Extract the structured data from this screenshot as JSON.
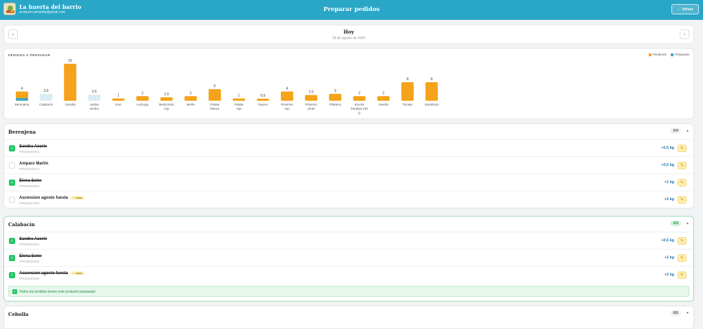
{
  "header": {
    "brand": "La huerta del barrio",
    "email": "ar.daurm.amanda@gmail.com",
    "title": "Preparar pedidos",
    "back_label": "← Volver"
  },
  "date": {
    "main": "Hoy",
    "sub": "18 de agosto de 2026",
    "prev": "‹",
    "next": "›"
  },
  "chart_title": "PEDIDOS A PREPARAR",
  "chart_data": {
    "type": "bar",
    "categories": [
      "Berenjena",
      "Calabacín",
      "Cebolla",
      "Judías verdes",
      "Kiwi",
      "Lechuga",
      "Melóctotón rojo",
      "Melón",
      "Patata blanca",
      "Patata roja",
      "Pepino",
      "Pimiento rojo",
      "Pimiento verde",
      "Plátanos",
      "Escola bandeja 100 g",
      "Sandía",
      "Tomate",
      "Zanahoria"
    ],
    "value_labels": [
      "4",
      "3.0",
      "16",
      "2.6",
      "1",
      "2",
      "1.5",
      "2",
      "5",
      "1",
      "0.5",
      "4",
      "2.5",
      "3",
      "2",
      "2",
      "8",
      "8"
    ],
    "series": [
      {
        "name": "Pendiente",
        "values": [
          2.8,
          0,
          16,
          0,
          1,
          2,
          1.5,
          2,
          5,
          1,
          0.5,
          4,
          2.5,
          3,
          2,
          2,
          8,
          8
        ]
      },
      {
        "name": "Preparado",
        "values": [
          1.2,
          3,
          0,
          2.6,
          0,
          0,
          0,
          0,
          0,
          0,
          0,
          0,
          0,
          0,
          0,
          0,
          0,
          0
        ]
      }
    ],
    "colors": {
      "pendiente": "#f5a31a",
      "preparado": "#43a8c2",
      "preparado_light": "#d9ecf2"
    },
    "ylim": [
      0,
      16
    ],
    "legend": "top-right"
  },
  "legend": {
    "pending": "Pendiente",
    "done": "Preparado"
  },
  "sections": [
    {
      "title": "Berenjena",
      "count": "2/4",
      "done": false,
      "chevron": "▲",
      "rows": [
        {
          "name": "Sandra Azorín",
          "id": "#PED8480001",
          "qty": "+0,5 kg",
          "checked": true,
          "strike": true,
          "note": ""
        },
        {
          "name": "Amparo Martín",
          "id": "#PED8429474",
          "qty": "+0,5 kg",
          "checked": false,
          "strike": false,
          "note": ""
        },
        {
          "name": "Elena Soler",
          "id": "#PED8432855",
          "qty": "+1 kg",
          "checked": true,
          "strike": true,
          "note": ""
        },
        {
          "name": "Ascension agosto fuesta",
          "id": "#PED8453385",
          "qty": "+2 kg",
          "checked": false,
          "strike": false,
          "note": "☆ Nota"
        }
      ]
    },
    {
      "title": "Calabacín",
      "count": "3/3",
      "done": true,
      "chevron": "▲",
      "rows": [
        {
          "name": "Sandra Azorín",
          "id": "#PED8480001",
          "qty": "+0,5 kg",
          "checked": true,
          "strike": true,
          "note": ""
        },
        {
          "name": "Elena Soler",
          "id": "#PED8432855",
          "qty": "+1 kg",
          "checked": true,
          "strike": true,
          "note": ""
        },
        {
          "name": "Ascension agosto fuesta",
          "id": "#PED8453385",
          "qty": "+2 kg",
          "checked": true,
          "strike": true,
          "note": "☆ Nota"
        }
      ],
      "notice": "Todos los pedidos tienen este producto preparado"
    },
    {
      "title": "Cebolla",
      "count": "0/5",
      "done": false,
      "chevron": "▼",
      "rows": []
    }
  ],
  "icons": {
    "check": "✓",
    "edit": "✎",
    "check_icon": "check-icon",
    "edit_icon": "pencil-icon"
  }
}
